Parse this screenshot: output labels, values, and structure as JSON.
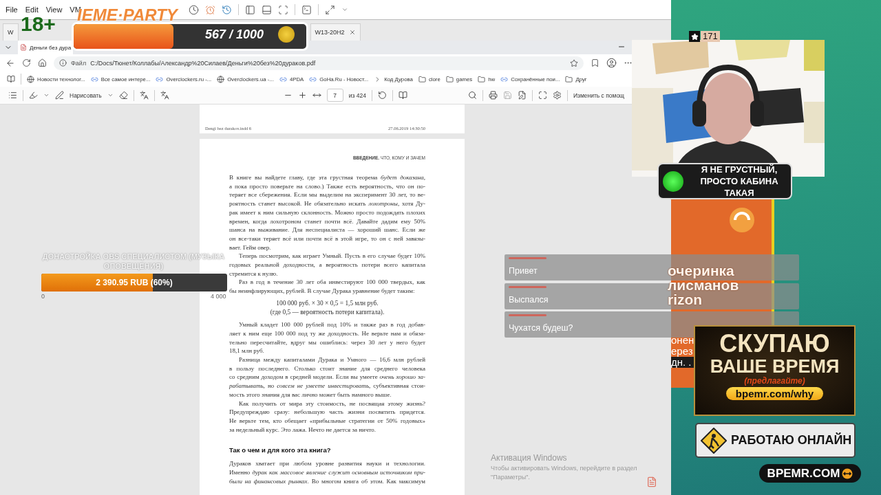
{
  "vm_menu": [
    "File",
    "Edit",
    "View",
    "VM"
  ],
  "vm_tabs": [
    {
      "label": "W",
      "selected": false,
      "closable": false
    },
    {
      "label": "W13-20H2",
      "selected": false,
      "closable": true
    }
  ],
  "browser_tab": {
    "title": "Деньги без дура"
  },
  "address": {
    "scheme_label": "Файл",
    "url": "C:/Docs/Тюнет/Коллабы/Александр%20Силаев/Деньги%20без%20дураков.pdf"
  },
  "bookmarks": [
    {
      "label": "Новости технолог...",
      "kind": "globe"
    },
    {
      "label": "Все самое интере...",
      "kind": "site"
    },
    {
      "label": "Overclockers.ru -...",
      "kind": "site"
    },
    {
      "label": "Overclockers.ua -...",
      "kind": "globe"
    },
    {
      "label": "4PDA",
      "kind": "site"
    },
    {
      "label": "GoHa.Ru - Новост...",
      "kind": "site"
    },
    {
      "label": "Код Дурова",
      "kind": "chevron"
    },
    {
      "label": "clore",
      "kind": "folder"
    },
    {
      "label": "games",
      "kind": "folder"
    },
    {
      "label": "hw",
      "kind": "folder"
    },
    {
      "label": "Сохранённые пои...",
      "kind": "site"
    },
    {
      "label": "Друг",
      "kind": "folder"
    }
  ],
  "pdf_toolbar": {
    "draw_label": "Нарисовать",
    "page": "7",
    "page_total": "из 424",
    "edit_label": "Изменить с помощ"
  },
  "pdf": {
    "prev_footer": {
      "left": "Dengi bez durakov.indd 6",
      "right": "27.06.2019 14:30:50"
    },
    "running_head": "**ВВЕДЕНИЕ.** ЧТО, КОМУ И ЗАЧЕМ",
    "blocks": [
      {
        "kind": "text",
        "indent": false,
        "continues": false,
        "lines": [
          "В книге вы найдете главу, где эта грустная теорема *будет доказана*,",
          "а пока просто поверьте на слово.) Также есть вероятность, что он по-",
          "теряет все сбережения. Если мы выделим на эксперимент 30 лет, то ве-",
          "роятность станет высокой. Не обязательно искать *лохотроны*, хотя Ду-",
          "рак имеет к ним сильную склонность. Можно просто подождать плохих",
          "времен, когда лохотроном станет почти всё. Давайте дадим ему 50%",
          "шанса на выживание. Для неспециалиста — хороший шанс. Если же",
          "он все-таки теряет всё или почти всё в этой игре, то он с ней завязы-",
          "вает. Гейм овер."
        ]
      },
      {
        "kind": "text",
        "indent": true,
        "continues": false,
        "lines": [
          "Теперь посмотрим, как играет Умный. Пусть в его случае будет 10%",
          "годовых реальной доходности, а вероятность потери всего капитала",
          "стремится к нулю."
        ]
      },
      {
        "kind": "text",
        "indent": true,
        "continues": false,
        "lines": [
          "Раз в год в течение 30 лет оба инвестируют 100 000 твердых, как",
          "бы неинфлирующих, рублей. В случае Дурака уравнение будет таким:"
        ]
      },
      {
        "kind": "formula",
        "lines": [
          "100 000 руб. × 30 × 0,5 = 1,5 млн руб.",
          "(где 0,5 — вероятность потери капитала)."
        ]
      },
      {
        "kind": "text",
        "indent": true,
        "continues": false,
        "lines": [
          "Умный кладет 100 000 рублей под 10% и также раз в год добав-",
          "ляет к ним еще 100 000 под ту же доходность. Не верьте нам и обяза-",
          "тельно пересчитайте, вдруг мы ошиблись: через 30 лет у него будет",
          "18,1 млн руб."
        ]
      },
      {
        "kind": "text",
        "indent": true,
        "continues": false,
        "lines": [
          "Разница между капиталами Дурака и Умного — 16,6 млн рублей",
          "в пользу последнего. Столько стоит знание для среднего человека",
          "со средним доходом в средней модели. Если вы умеете *очень хорошо за-*",
          "*рабатывать*, но *совсем не умеете инвестировать*, субъективная стои-",
          "мость этого знания для вас лично может быть намного выше."
        ]
      },
      {
        "kind": "text",
        "indent": true,
        "continues": false,
        "lines": [
          "Как получить от мира эту стоимость, не посвящая этому жизнь?",
          "Предупреждаю сразу: небольшую часть жизни посвятить придется.",
          "Не верьте тем, кто обещает «прибыльные стратегии от 50% годовых»",
          "за недельный курс. Это лажа. Нечто не дается за ничто."
        ]
      },
      {
        "kind": "heading",
        "lines": [
          "Так о чем и для кого эта книга?"
        ]
      },
      {
        "kind": "text",
        "indent": false,
        "continues": true,
        "lines": [
          "Дураков хватает при любом уровне развития науки и технологии.",
          "Именно *дурак как массовое явление служит основным источником при-*",
          "*были на финансовых рынках*. Во многом книга об этом. Как максимум"
        ]
      }
    ]
  },
  "stream": {
    "age_badge": "18+",
    "meme_party": {
      "title": "IEME·PARTY",
      "reading": "567 / 1000",
      "level": 0.43
    },
    "donation_goal": {
      "title": "ДОНАСТРОЙКА OBS СПЕЦИАЛИСТОМ (МУЗЫКА ОПОВЕЩЕНИЯ)",
      "amount": "2 390.95 RUB (60%)",
      "level": 0.6,
      "min": "0",
      "max": "4 000"
    },
    "chat": [
      {
        "text": "Привет"
      },
      {
        "text": "Выспался"
      },
      {
        "text": "Чухатся будеш?"
      }
    ],
    "windows_activation": {
      "title": "Активация Windows",
      "body": "Чтобы активировать Windows, перейдите в раздел \"Параметры\"."
    },
    "viewer_count": "171",
    "mood_badge": [
      "Я НЕ ГРУСТНЫЙ,",
      "ПРОСТО КАБИНА ТАКАЯ"
    ],
    "event_banner": {
      "title_lines": [
        "очеринка",
        "лисманов",
        "rizon"
      ],
      "detail_lines": [
        "онен",
        "ерез",
        "дн. ."
      ]
    },
    "promo": {
      "lines": [
        "СКУПАЮ",
        "ВАШЕ ВРЕМЯ"
      ],
      "note": "(предлагайте)",
      "link": "bpemr.com/why"
    },
    "work_sign": "РАБОТАЮ ОНЛАЙН",
    "site_badge": "BPEMR.COM"
  }
}
